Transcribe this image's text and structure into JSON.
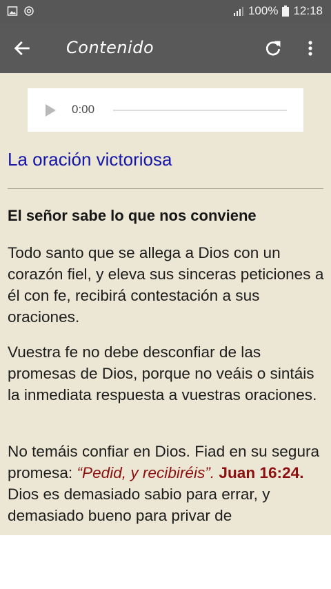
{
  "status_bar": {
    "left_icons": [
      "image-icon",
      "sync-icon"
    ],
    "battery_percent": "100%",
    "time": "12:18"
  },
  "app_bar": {
    "title": "Contenido",
    "back_icon": "arrow-left-icon",
    "refresh_icon": "refresh-icon",
    "more_icon": "more-vertical-icon"
  },
  "audio_player": {
    "current_time": "0:00",
    "progress": 0
  },
  "article": {
    "title": "La oración victoriosa",
    "subtitle": "El señor sabe lo que nos conviene",
    "paragraph_1": "Todo santo que se allega a Dios con un corazón fiel, y eleva sus sinceras peticiones a él con fe, recibirá contestación a sus oraciones.",
    "paragraph_2": "Vuestra fe no debe desconfiar de las promesas de Dios, porque no veáis o sintáis la inmediata respuesta a vuestras oraciones.",
    "paragraph_3_start": "No temáis confiar en Dios. Fiad en su segura promesa: ",
    "paragraph_3_quote": "“Pedid, y recibiréis”",
    "paragraph_3_dot": ". ",
    "paragraph_3_reference": "Juan 16:24.",
    "paragraph_3_rest": " Dios es demasiado sabio para errar, y demasiado bueno para privar de"
  },
  "colors": {
    "status_bar": "#575757",
    "app_bar": "#595959",
    "content_background": "#ece6d4",
    "title_blue": "#1515a8",
    "quote_red": "#8b0f0f"
  }
}
